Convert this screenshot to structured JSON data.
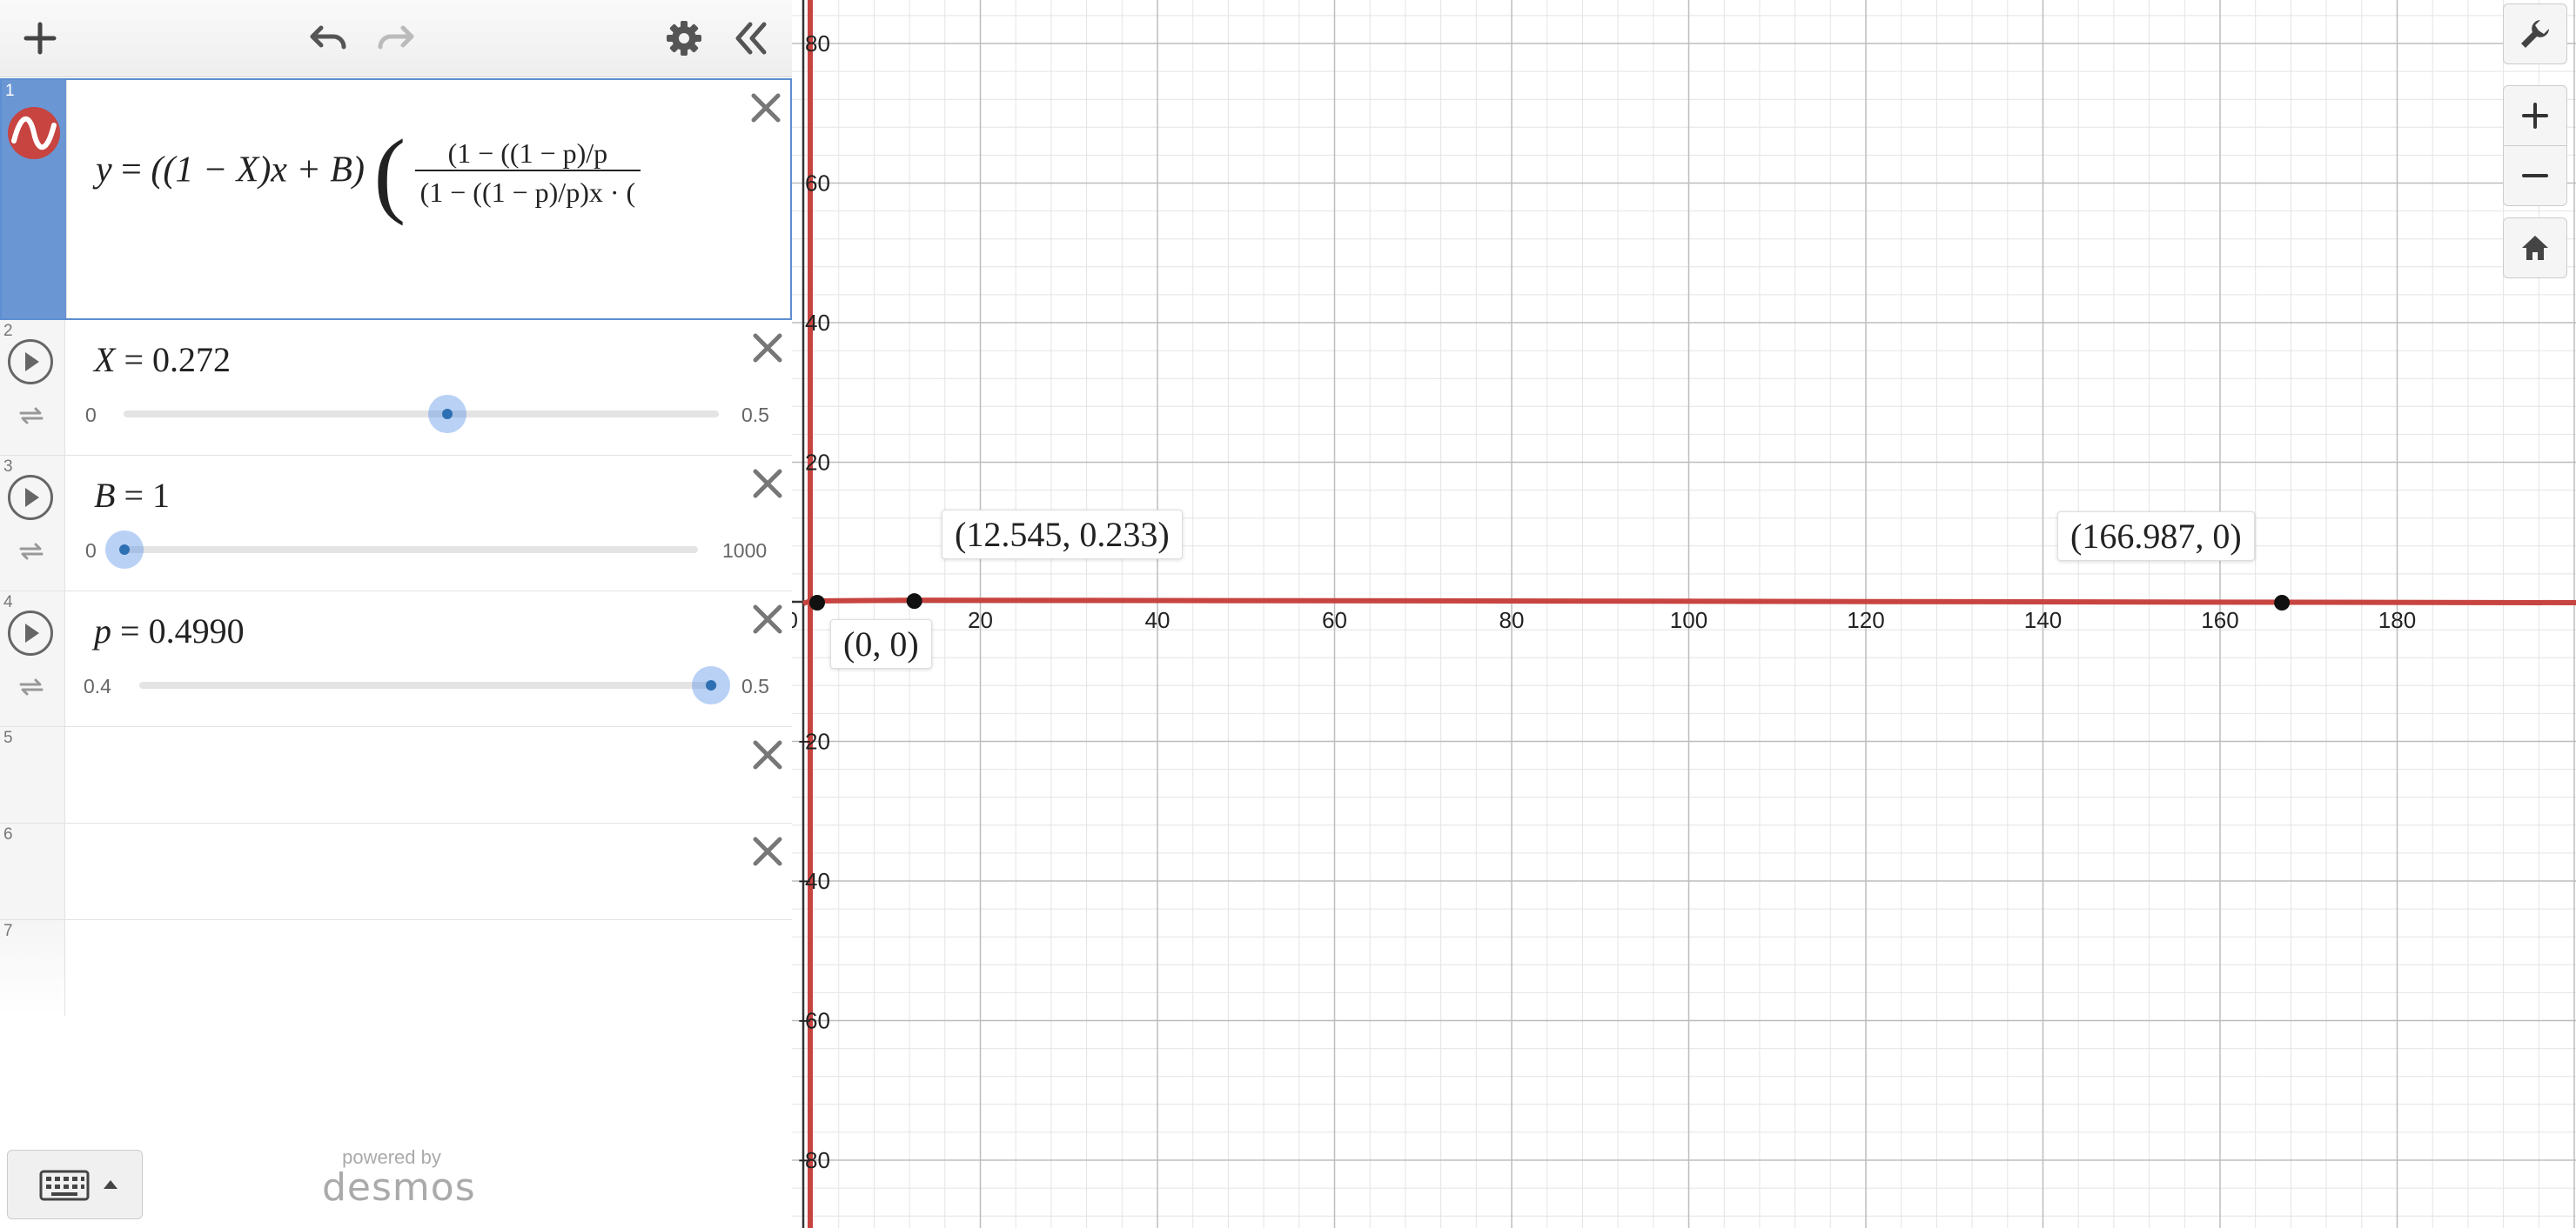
{
  "toolbar": {
    "add_icon": "plus-icon",
    "undo_icon": "undo-icon",
    "redo_icon": "redo-icon",
    "settings_icon": "gear-icon",
    "collapse_icon": "double-chevron-left-icon"
  },
  "expressions": [
    {
      "index": "1",
      "type": "formula",
      "selected": true
    },
    {
      "index": "2",
      "type": "slider",
      "variable": "X",
      "value": "0.272",
      "min": "0",
      "max": "0.5",
      "fraction": 0.544
    },
    {
      "index": "3",
      "type": "slider",
      "variable": "B",
      "value": "1",
      "min": "0",
      "max": "1000",
      "fraction": 0.001
    },
    {
      "index": "4",
      "type": "slider",
      "variable": "p",
      "value": "0.4990",
      "min": "0.4",
      "max": "0.5",
      "fraction": 0.99
    },
    {
      "index": "5",
      "type": "empty"
    },
    {
      "index": "6",
      "type": "empty"
    },
    {
      "index": "7",
      "type": "empty"
    }
  ],
  "formula": {
    "lhs": "y",
    "equals": "=",
    "prefix": "((1 − X)x + B)",
    "numerator": "(1 − ((1 − p)/p",
    "denominator": "(1 − ((1 − p)/p)x · ("
  },
  "footer": {
    "powered_by": "powered by",
    "brand": "desmos"
  },
  "graph": {
    "x_ticks": [
      "0",
      "20",
      "40",
      "60",
      "80",
      "100",
      "120",
      "140",
      "160",
      "180"
    ],
    "y_ticks": [
      "80",
      "60",
      "40",
      "20",
      "20",
      "40",
      "60",
      "80"
    ],
    "curve_color": "#c74440",
    "point_labels": [
      "(12.545, 0.233)",
      "(166.987, 0)",
      "(0, 0)"
    ],
    "points": [
      {
        "x": 12.545,
        "y": 0.233
      },
      {
        "x": 166.987,
        "y": 0
      },
      {
        "x": 0,
        "y": 0
      }
    ]
  },
  "zoom_tools": {
    "settings_icon": "wrench-icon",
    "zoom_in_icon": "plus-icon",
    "zoom_out_icon": "minus-icon",
    "home_icon": "home-icon"
  }
}
